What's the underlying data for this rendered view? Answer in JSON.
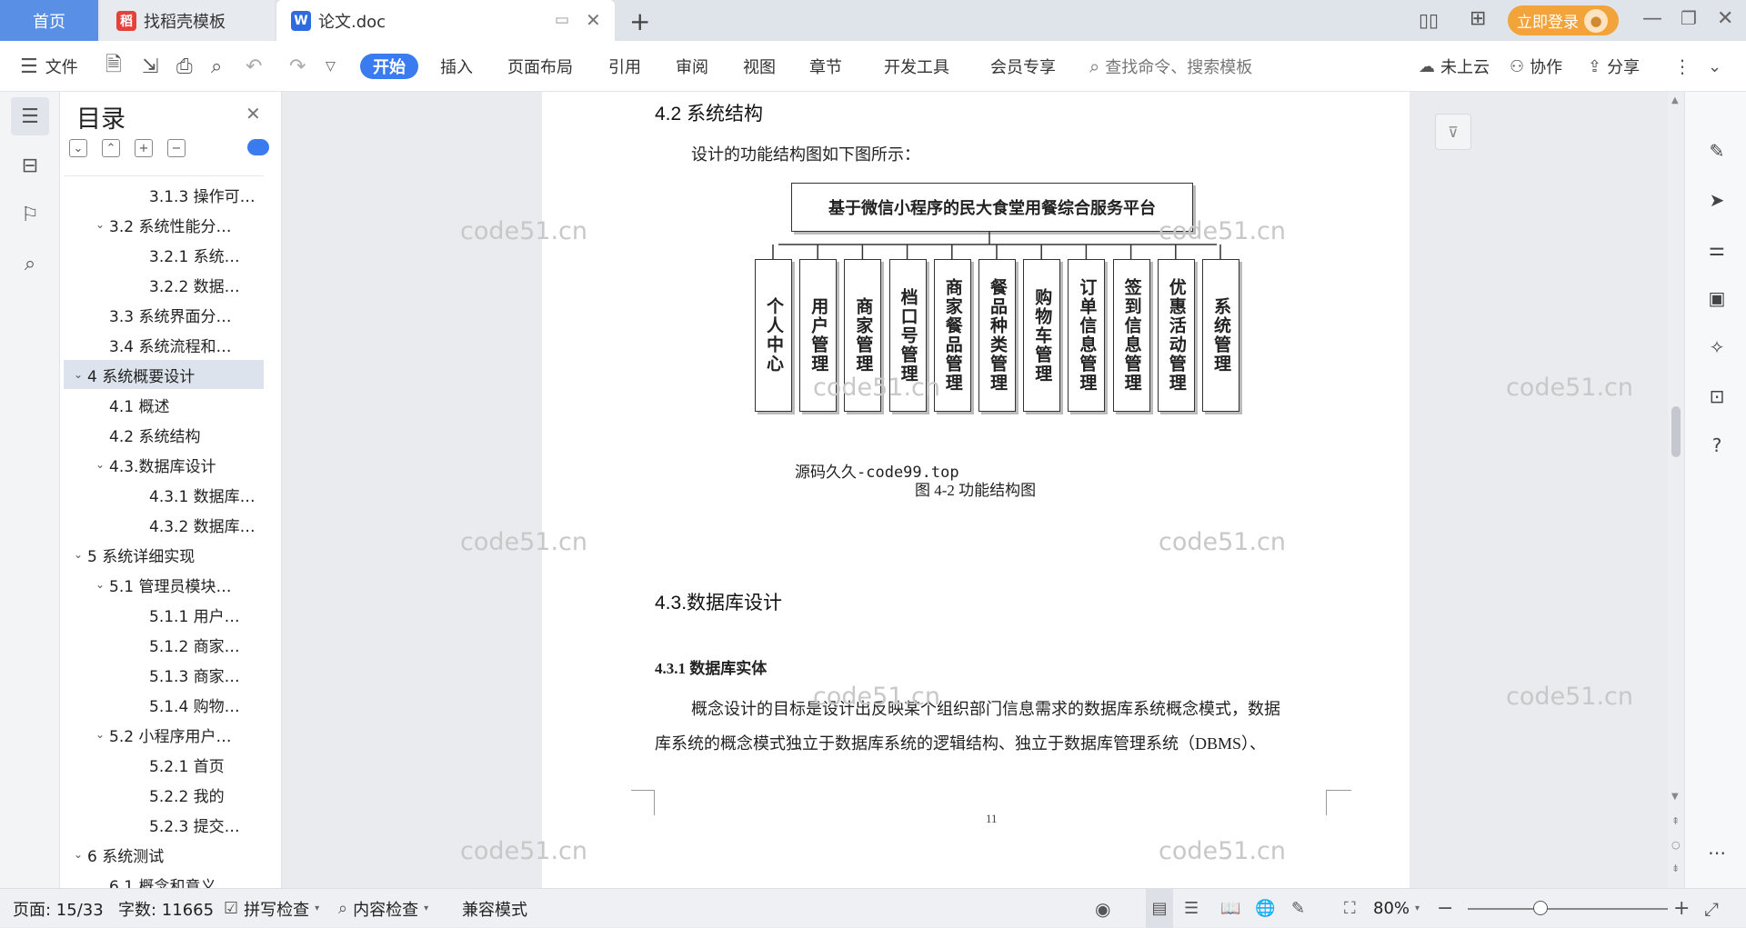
{
  "tabs": {
    "home": "首页",
    "templates": "找稻壳模板",
    "document": "论文.doc"
  },
  "titlebar": {
    "login": "立即登录"
  },
  "toolbar": {
    "file": "文件",
    "ribbon": [
      "开始",
      "插入",
      "页面布局",
      "引用",
      "审阅",
      "视图",
      "章节",
      "开发工具",
      "会员专享"
    ],
    "search_placeholder": "查找命令、搜索模板",
    "cloud": "未上云",
    "collab": "协作",
    "share": "分享"
  },
  "toc": {
    "title": "目录",
    "items": [
      {
        "label": "3.1.3 操作可…",
        "level": 3,
        "chevron": ""
      },
      {
        "label": "3.2 系统性能分…",
        "level": 2,
        "chevron": "v"
      },
      {
        "label": "3.2.1  系统…",
        "level": 3,
        "chevron": ""
      },
      {
        "label": "3.2.2  数据…",
        "level": 3,
        "chevron": ""
      },
      {
        "label": "3.3 系统界面分…",
        "level": 2,
        "chevron": ""
      },
      {
        "label": "3.4 系统流程和…",
        "level": 2,
        "chevron": ""
      },
      {
        "label": "4 系统概要设计",
        "level": 1,
        "chevron": "v",
        "selected": true
      },
      {
        "label": "4.1 概述",
        "level": 2,
        "chevron": ""
      },
      {
        "label": "4.2 系统结构",
        "level": 2,
        "chevron": ""
      },
      {
        "label": "4.3.数据库设计",
        "level": 2,
        "chevron": "v"
      },
      {
        "label": "4.3.1 数据库…",
        "level": 3,
        "chevron": ""
      },
      {
        "label": "4.3.2 数据库…",
        "level": 3,
        "chevron": ""
      },
      {
        "label": "5 系统详细实现",
        "level": 1,
        "chevron": "v"
      },
      {
        "label": "5.1  管理员模块…",
        "level": 2,
        "chevron": "v"
      },
      {
        "label": "5.1.1  用户…",
        "level": 3,
        "chevron": ""
      },
      {
        "label": "5.1.2  商家…",
        "level": 3,
        "chevron": ""
      },
      {
        "label": "5.1.3  商家…",
        "level": 3,
        "chevron": ""
      },
      {
        "label": "5.1.4  购物…",
        "level": 3,
        "chevron": ""
      },
      {
        "label": "5.2  小程序用户…",
        "level": 2,
        "chevron": "v"
      },
      {
        "label": "5.2.1  首页",
        "level": 3,
        "chevron": ""
      },
      {
        "label": "5.2.2  我的",
        "level": 3,
        "chevron": ""
      },
      {
        "label": "5.2.3  提交…",
        "level": 3,
        "chevron": ""
      },
      {
        "label": "6 系统测试",
        "level": 1,
        "chevron": "v"
      },
      {
        "label": "6.1 概念和意义",
        "level": 2,
        "chevron": ""
      }
    ]
  },
  "document": {
    "heading_42": "4.2 系统结构",
    "intro": "设计的功能结构图如下图所示：",
    "diagram_root": "基于微信小程序的民大食堂用餐综合服务平台",
    "diagram_leaves": [
      "个人中心",
      "用户管理",
      "商家管理",
      "档口号管理",
      "商家餐品管理",
      "餐品种类管理",
      "购物车管理",
      "订单信息管理",
      "签到信息管理",
      "优惠活动管理",
      "系统管理"
    ],
    "source_mark": "源码久久-code99.top",
    "caption": "图 4-2 功能结构图",
    "heading_43": "4.3.数据库设计",
    "heading_431": "4.3.1 数据库实体",
    "para1": "概念设计的目标是设计出反映某个组织部门信息需求的数据库系统概念模式，数据",
    "para2": "库系统的概念模式独立于数据库系统的逻辑结构、独立于数据库管理系统（DBMS）、",
    "page_number": "11",
    "watermark": "code51.cn"
  },
  "statusbar": {
    "page": "页面: 15/33",
    "words": "字数: 11665",
    "spell": "拼写检查",
    "content_check": "内容检查",
    "compat": "兼容模式",
    "zoom": "80%"
  },
  "colors": {
    "accent": "#3a7cf0",
    "login": "#f2a33a",
    "home_tab": "#5a8fe6"
  }
}
